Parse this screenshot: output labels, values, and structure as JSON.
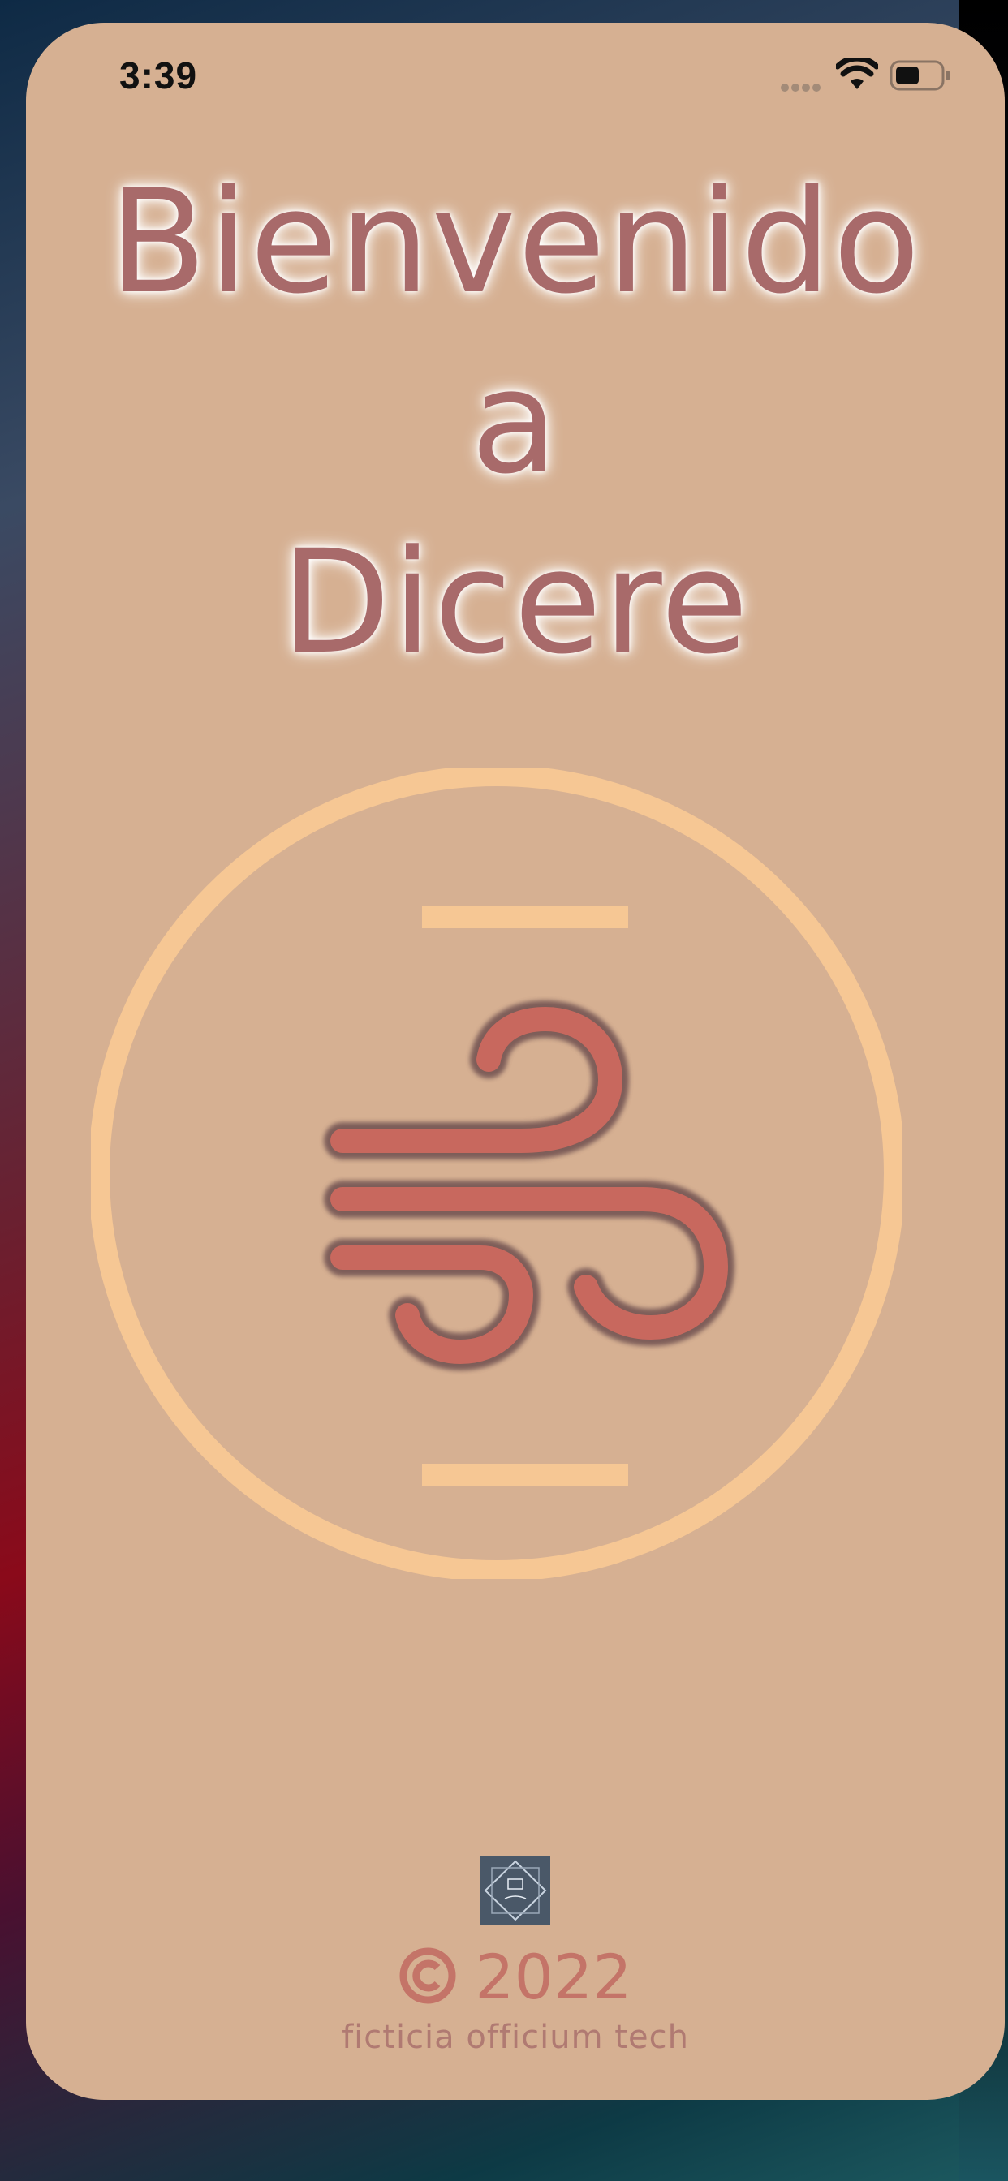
{
  "status_bar": {
    "time": "3:39",
    "icons": [
      "cellular-signal-icon",
      "wifi-icon",
      "battery-icon"
    ]
  },
  "welcome": {
    "line1": "Bienvenido",
    "line2": "a",
    "line3": "Dicere"
  },
  "logo": {
    "icon": "wind-icon",
    "ring_color": "#f6c794",
    "symbol_color": "#c8685e"
  },
  "footer": {
    "company_logo_icon": "company-logo-icon",
    "year": "2022",
    "company_name": "ficticia officium tech"
  },
  "colors": {
    "background": "#d6b092",
    "title": "#a86a6a",
    "accent": "#f6c794",
    "footer_text": "#c47468"
  }
}
